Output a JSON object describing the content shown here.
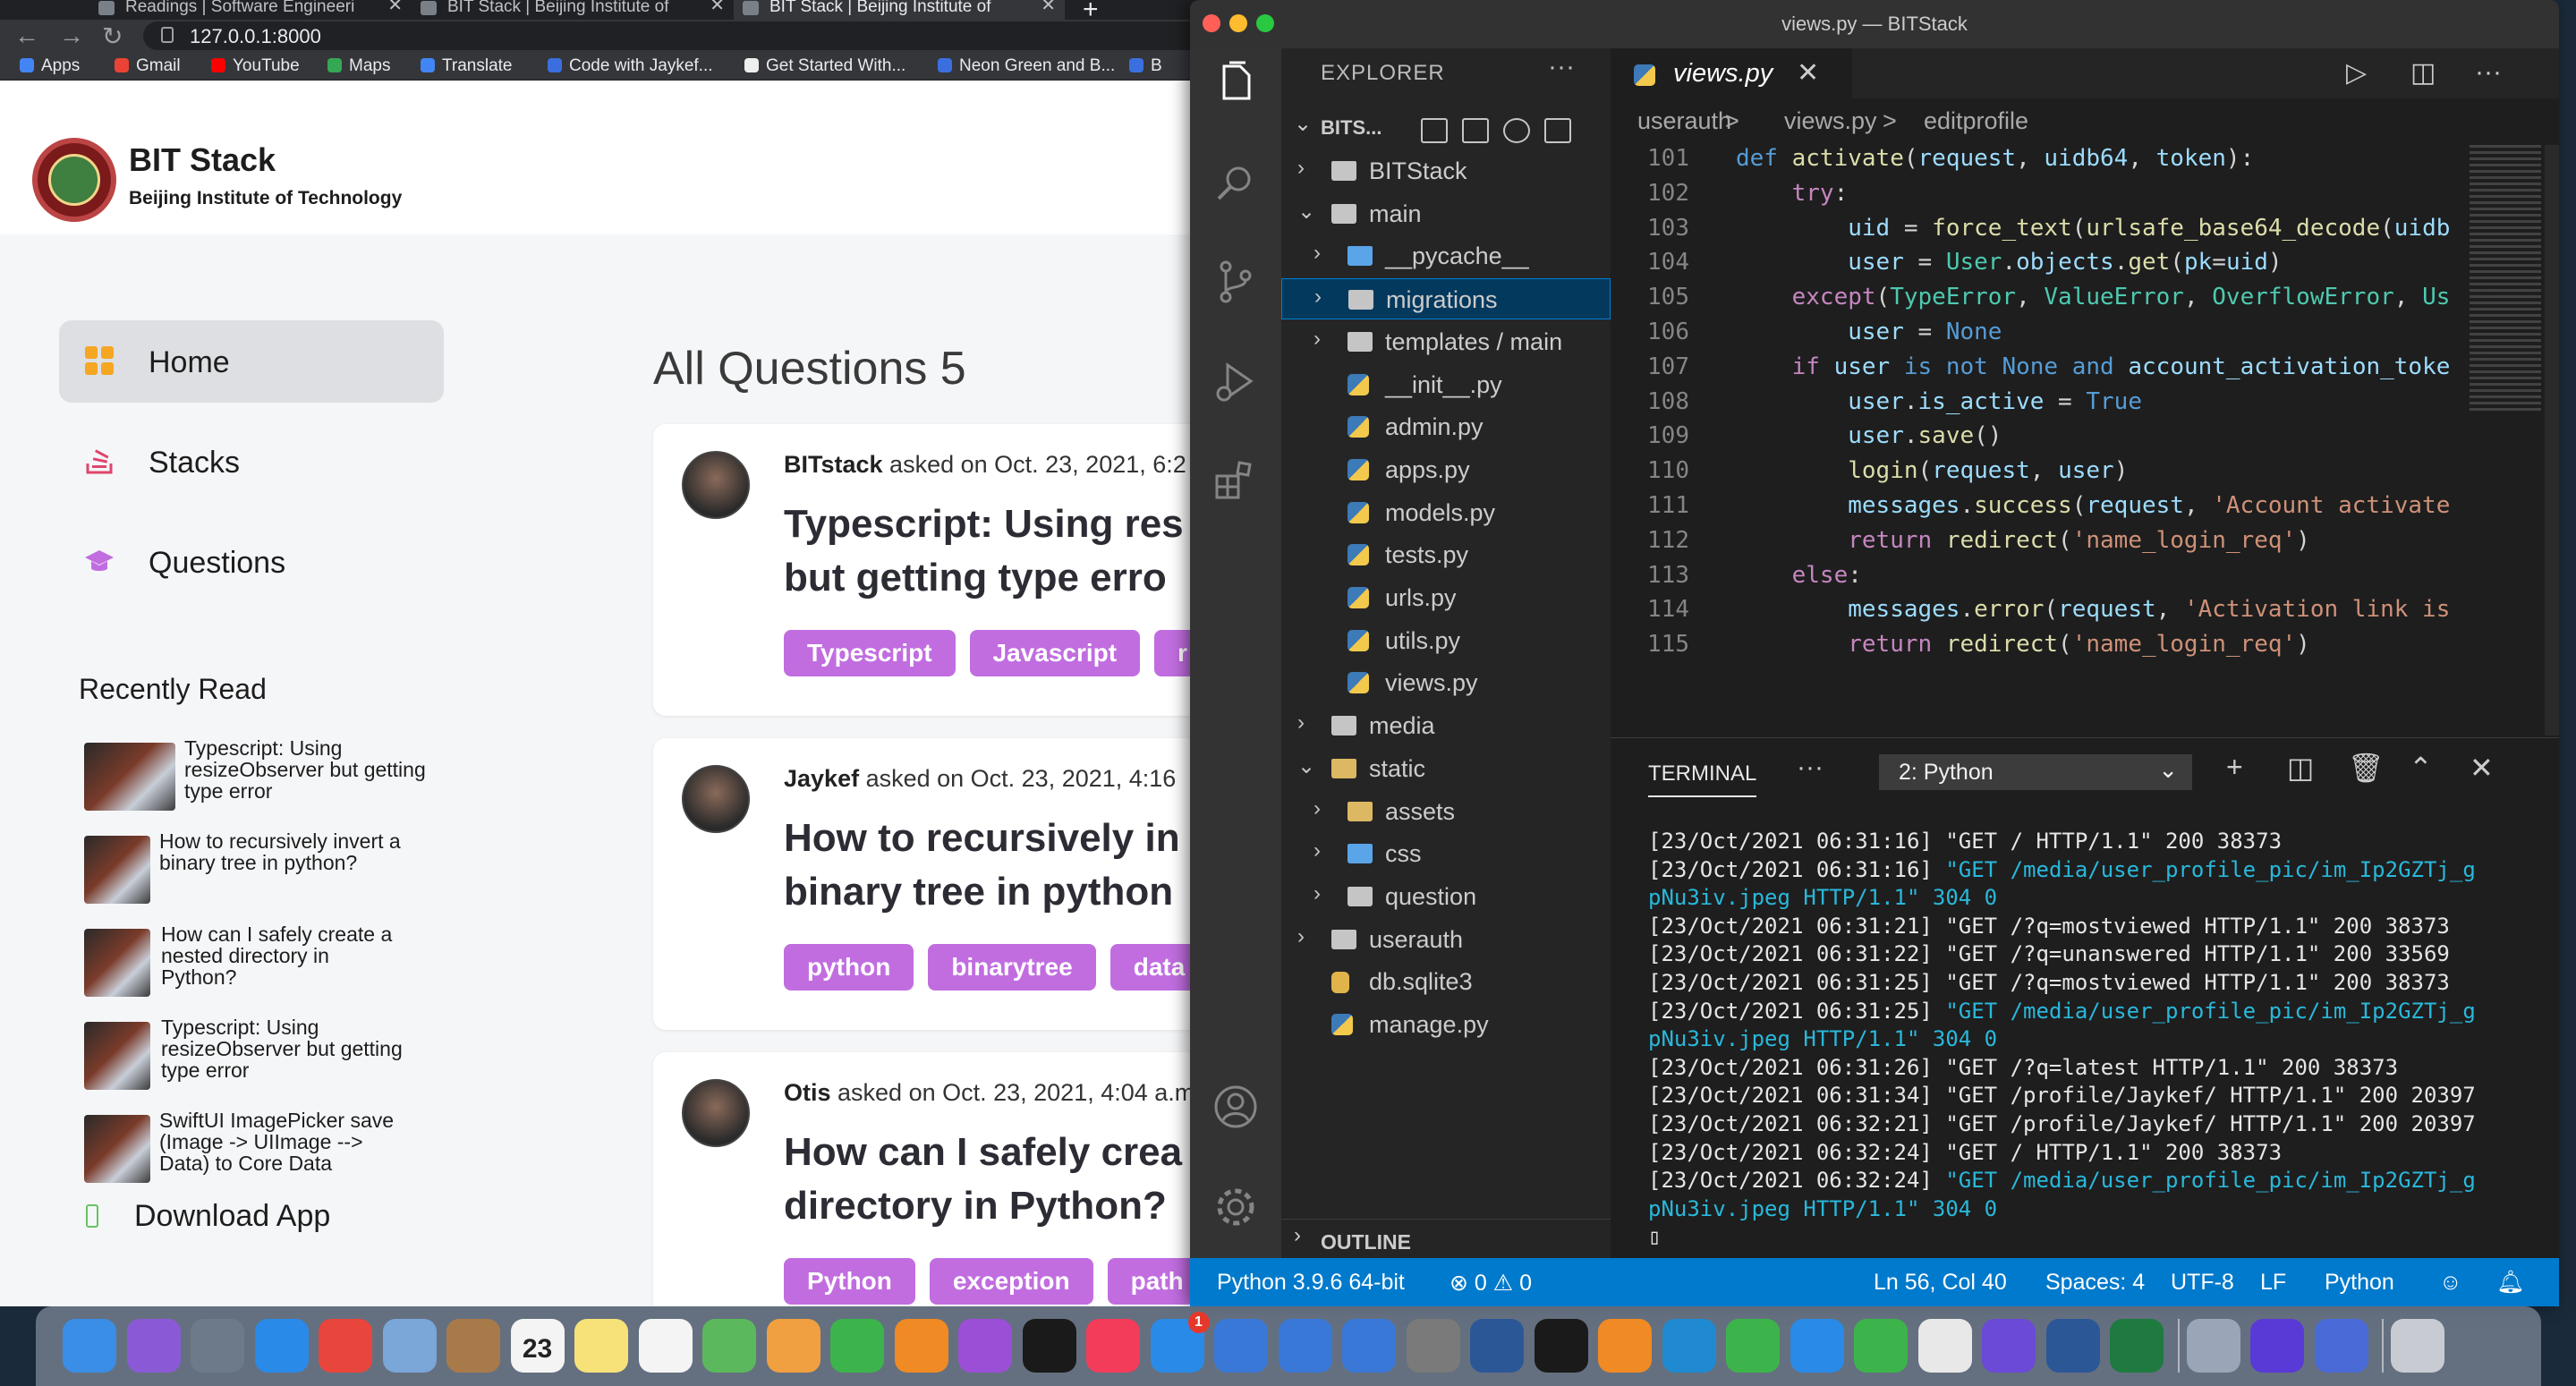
{
  "browser": {
    "tabs": [
      {
        "label": "Readings | Software Engineeri"
      },
      {
        "label": "BIT Stack | Beijing Institute of"
      },
      {
        "label": "BIT Stack | Beijing Institute of"
      }
    ],
    "tab_close_glyph": "✕",
    "new_tab_glyph": "+",
    "back_glyph": "←",
    "forward_glyph": "→",
    "reload_glyph": "↻",
    "url": "127.0.0.1:8000",
    "bookmarks": [
      {
        "label": "Apps",
        "color": "#4285f4"
      },
      {
        "label": "Gmail",
        "color": "#ea4335"
      },
      {
        "label": "YouTube",
        "color": "#ff0000"
      },
      {
        "label": "Maps",
        "color": "#34a853"
      },
      {
        "label": "Translate",
        "color": "#4285f4"
      },
      {
        "label": "Code with Jaykef...",
        "color": "#3b6fe0"
      },
      {
        "label": "Get Started With...",
        "color": "#eeeeee"
      },
      {
        "label": "Neon Green and B...",
        "color": "#3b6fe0"
      },
      {
        "label": "B",
        "color": "#3b6fe0"
      }
    ]
  },
  "site": {
    "title": "BIT Stack",
    "subtitle": "Beijing Institute of Technology",
    "nav": [
      {
        "label": "Home",
        "icon": "grid-icon",
        "color": "#f5a623"
      },
      {
        "label": "Stacks",
        "icon": "stack-icon",
        "color": "#e0456b"
      },
      {
        "label": "Questions",
        "icon": "graduation-cap-icon",
        "color": "#c16de0"
      }
    ],
    "recently_read_title": "Recently Read",
    "recently_read": [
      {
        "title": "Typescript: Using resizeObserver but getting type error"
      },
      {
        "title": "How to recursively invert a binary tree in python?"
      },
      {
        "title": "How can I safely create a nested directory in Python?"
      },
      {
        "title": "Typescript: Using resizeObserver but getting type error"
      },
      {
        "title": "SwiftUI ImagePicker save (Image -> UIImage --> Data) to Core Data"
      }
    ],
    "download_app": "Download App",
    "questions_header": "All Questions 5",
    "questions": [
      {
        "author": "BITstack",
        "meta": " asked on Oct. 23, 2021, 6:2",
        "title": "Typescript: Using res\nbut getting type erro",
        "tags": [
          "Typescript",
          "Javascript",
          "r"
        ]
      },
      {
        "author": "Jaykef",
        "meta": " asked on Oct. 23, 2021, 4:16",
        "title": "How to recursively in\nbinary tree in python",
        "tags": [
          "python",
          "binarytree",
          "data"
        ]
      },
      {
        "author": "Otis",
        "meta": " asked on Oct. 23, 2021, 4:04 a.m",
        "title": "How can I safely crea\ndirectory in Python?",
        "tags": [
          "Python",
          "exception",
          "path"
        ]
      }
    ],
    "tag_color": "#c16de0"
  },
  "vscode": {
    "window_title": "views.py — BITStack",
    "explorer_title": "EXPLORER",
    "more_glyph": "···",
    "root_label": "BITS...",
    "tree": [
      {
        "label": "BITStack",
        "type": "folder",
        "depth": 0,
        "expanded": false
      },
      {
        "label": "main",
        "type": "folder",
        "depth": 0,
        "expanded": true
      },
      {
        "label": "__pycache__",
        "type": "folder-blue",
        "depth": 1,
        "expanded": false
      },
      {
        "label": "migrations",
        "type": "folder",
        "depth": 1,
        "expanded": false,
        "selected": true
      },
      {
        "label": "templates / main",
        "type": "folder",
        "depth": 1,
        "expanded": false
      },
      {
        "label": "__init__.py",
        "type": "py",
        "depth": 1
      },
      {
        "label": "admin.py",
        "type": "py",
        "depth": 1
      },
      {
        "label": "apps.py",
        "type": "py",
        "depth": 1
      },
      {
        "label": "models.py",
        "type": "py",
        "depth": 1
      },
      {
        "label": "tests.py",
        "type": "py",
        "depth": 1
      },
      {
        "label": "urls.py",
        "type": "py",
        "depth": 1
      },
      {
        "label": "utils.py",
        "type": "py",
        "depth": 1
      },
      {
        "label": "views.py",
        "type": "py",
        "depth": 1
      },
      {
        "label": "media",
        "type": "folder",
        "depth": 0,
        "expanded": false
      },
      {
        "label": "static",
        "type": "folder-yellow",
        "depth": 0,
        "expanded": true
      },
      {
        "label": "assets",
        "type": "folder-yellow",
        "depth": 1,
        "expanded": false
      },
      {
        "label": "css",
        "type": "folder-blue",
        "depth": 1,
        "expanded": false
      },
      {
        "label": "question",
        "type": "folder",
        "depth": 1,
        "expanded": false
      },
      {
        "label": "userauth",
        "type": "folder",
        "depth": 0,
        "expanded": false
      },
      {
        "label": "db.sqlite3",
        "type": "db",
        "depth": 0
      },
      {
        "label": "manage.py",
        "type": "py",
        "depth": 0
      }
    ],
    "outline_label": "OUTLINE",
    "active_tab": "views.py",
    "breadcrumbs": [
      "userauth",
      ">",
      "views.py",
      ">",
      "editprofile"
    ],
    "code_lines": [
      {
        "n": "101",
        "html": "<span class='kb'>def</span> <span class='fn'>activate</span>(<span class='vr'>request</span>, <span class='vr'>uidb64</span>, <span class='vr'>token</span>):"
      },
      {
        "n": "102",
        "html": "    <span class='kw'>try</span>:"
      },
      {
        "n": "103",
        "html": "        <span class='vr'>uid</span> = <span class='fn'>force_text</span>(<span class='fn'>urlsafe_base64_decode</span>(<span class='vr'>uidb</span>"
      },
      {
        "n": "104",
        "html": "        <span class='vr'>user</span> = <span class='cs'>User</span>.<span class='vr'>objects</span>.<span class='fn'>get</span>(<span class='vr'>pk</span>=<span class='vr'>uid</span>)"
      },
      {
        "n": "105",
        "html": "    <span class='kw'>except</span>(<span class='cs'>TypeError</span>, <span class='cs'>ValueError</span>, <span class='cs'>OverflowError</span>, <span class='cs'>Us</span>"
      },
      {
        "n": "106",
        "html": "        <span class='vr'>user</span> = <span class='kb'>None</span>"
      },
      {
        "n": "107",
        "html": "    <span class='kw'>if</span> <span class='vr'>user</span> <span class='kb'>is not</span> <span class='kb'>None</span> <span class='kb'>and</span> <span class='vr'>account_activation_toke</span>"
      },
      {
        "n": "108",
        "html": "        <span class='vr'>user</span>.<span class='vr'>is_active</span> = <span class='kb'>True</span>"
      },
      {
        "n": "109",
        "html": "        <span class='vr'>user</span>.<span class='fn'>save</span>()"
      },
      {
        "n": "110",
        "html": "        <span class='fn'>login</span>(<span class='vr'>request</span>, <span class='vr'>user</span>)"
      },
      {
        "n": "111",
        "html": "        <span class='vr'>messages</span>.<span class='fn'>success</span>(<span class='vr'>request</span>, <span class='st'>'Account activate</span>"
      },
      {
        "n": "112",
        "html": "        <span class='kw'>return</span> <span class='fn'>redirect</span>(<span class='st'>'name_login_req'</span>)"
      },
      {
        "n": "113",
        "html": "    <span class='kw'>else</span>:"
      },
      {
        "n": "114",
        "html": "        <span class='vr'>messages</span>.<span class='fn'>error</span>(<span class='vr'>request</span>, <span class='st'>'Activation link is</span>"
      },
      {
        "n": "115",
        "html": "        <span class='kw'>return</span> <span class='fn'>redirect</span>(<span class='st'>'name_login_req'</span>)"
      }
    ],
    "panel_tab": "TERMINAL",
    "terminal_select": "2: Python",
    "terminal_lines": [
      {
        "text": "[23/Oct/2021 06:31:16] \"GET / HTTP/1.1\" 200 38373",
        "link": ""
      },
      {
        "text": "[23/Oct/2021 06:31:16] ",
        "link": "\"GET /media/user_profile_pic/im_Ip2GZTj_g"
      },
      {
        "text": "",
        "link": "pNu3iv.jpeg HTTP/1.1\" 304 0"
      },
      {
        "text": "[23/Oct/2021 06:31:21] \"GET /?q=mostviewed HTTP/1.1\" 200 38373",
        "link": ""
      },
      {
        "text": "[23/Oct/2021 06:31:22] \"GET /?q=unanswered HTTP/1.1\" 200 33569",
        "link": ""
      },
      {
        "text": "[23/Oct/2021 06:31:25] \"GET /?q=mostviewed HTTP/1.1\" 200 38373",
        "link": ""
      },
      {
        "text": "[23/Oct/2021 06:31:25] ",
        "link": "\"GET /media/user_profile_pic/im_Ip2GZTj_g"
      },
      {
        "text": "",
        "link": "pNu3iv.jpeg HTTP/1.1\" 304 0"
      },
      {
        "text": "[23/Oct/2021 06:31:26] \"GET /?q=latest HTTP/1.1\" 200 38373",
        "link": ""
      },
      {
        "text": "[23/Oct/2021 06:31:34] \"GET /profile/Jaykef/ HTTP/1.1\" 200 20397",
        "link": ""
      },
      {
        "text": "[23/Oct/2021 06:32:21] \"GET /profile/Jaykef/ HTTP/1.1\" 200 20397",
        "link": ""
      },
      {
        "text": "[23/Oct/2021 06:32:24] \"GET / HTTP/1.1\" 200 38373",
        "link": ""
      },
      {
        "text": "[23/Oct/2021 06:32:24] ",
        "link": "\"GET /media/user_profile_pic/im_Ip2GZTj_g"
      },
      {
        "text": "",
        "link": "pNu3iv.jpeg HTTP/1.1\" 304 0"
      },
      {
        "text": "▯",
        "link": ""
      }
    ],
    "status": {
      "interpreter": "Python 3.9.6 64-bit",
      "problems": "⊗ 0 ⚠ 0",
      "cursor": "Ln 56, Col 40",
      "spaces": "Spaces: 4",
      "encoding": "UTF-8",
      "eol": "LF",
      "language": "Python"
    },
    "accent": "#007acc"
  },
  "dock": {
    "calendar_day": "23",
    "badge": "1",
    "apps": [
      {
        "name": "finder-icon",
        "color": "#3a8ee6"
      },
      {
        "name": "siri-icon",
        "color": "#8a5ad6"
      },
      {
        "name": "launchpad-icon",
        "color": "#6d7a8a"
      },
      {
        "name": "safari-icon",
        "color": "#2a8ae8"
      },
      {
        "name": "chrome-icon",
        "color": "#e8453c"
      },
      {
        "name": "preview-icon",
        "color": "#7aa6d8"
      },
      {
        "name": "notebook-icon",
        "color": "#a87a4a"
      },
      {
        "name": "calendar-icon",
        "color": "#f4f4f4"
      },
      {
        "name": "notes-icon",
        "color": "#f7e27a"
      },
      {
        "name": "reminders-icon",
        "color": "#f4f4f4"
      },
      {
        "name": "maps-icon",
        "color": "#5cb85c"
      },
      {
        "name": "photos-icon",
        "color": "#f0a040"
      },
      {
        "name": "facetime-icon",
        "color": "#3cb44b"
      },
      {
        "name": "books-icon",
        "color": "#f08a24"
      },
      {
        "name": "podcasts-icon",
        "color": "#9b4fd6"
      },
      {
        "name": "tv-icon",
        "color": "#1a1a1a"
      },
      {
        "name": "music-icon",
        "color": "#f23c5a"
      },
      {
        "name": "app-store-icon",
        "color": "#2a8ae8"
      },
      {
        "name": "xcode-icon",
        "color": "#3a78d8"
      },
      {
        "name": "instruments-icon",
        "color": "#3a78d8"
      },
      {
        "name": "simulator-icon",
        "color": "#3a78d8"
      },
      {
        "name": "system-preferences-icon",
        "color": "#7a7a7a"
      },
      {
        "name": "word-icon",
        "color": "#2b5797"
      },
      {
        "name": "terminal-icon",
        "color": "#1a1a1a"
      },
      {
        "name": "sublime-icon",
        "color": "#f08a24"
      },
      {
        "name": "vscode-icon",
        "color": "#1f8ad2"
      },
      {
        "name": "wechat-icon",
        "color": "#3cb44b"
      },
      {
        "name": "zoom-icon",
        "color": "#2a8ae8"
      },
      {
        "name": "sync-icon",
        "color": "#3cb44b"
      },
      {
        "name": "mongodb-icon",
        "color": "#e8e8e8"
      },
      {
        "name": "imovie-icon",
        "color": "#6a4ad6"
      },
      {
        "name": "ms-word-icon",
        "color": "#2b5797"
      },
      {
        "name": "excel-icon",
        "color": "#1f7a3f"
      },
      {
        "name": "screenshot-icon",
        "color": "#9aa6b8"
      },
      {
        "name": "app-icon",
        "color": "#5a3ad6"
      },
      {
        "name": "browser-icon",
        "color": "#4a6ad8"
      },
      {
        "name": "trash-icon",
        "color": "#c8ccd2"
      }
    ]
  }
}
